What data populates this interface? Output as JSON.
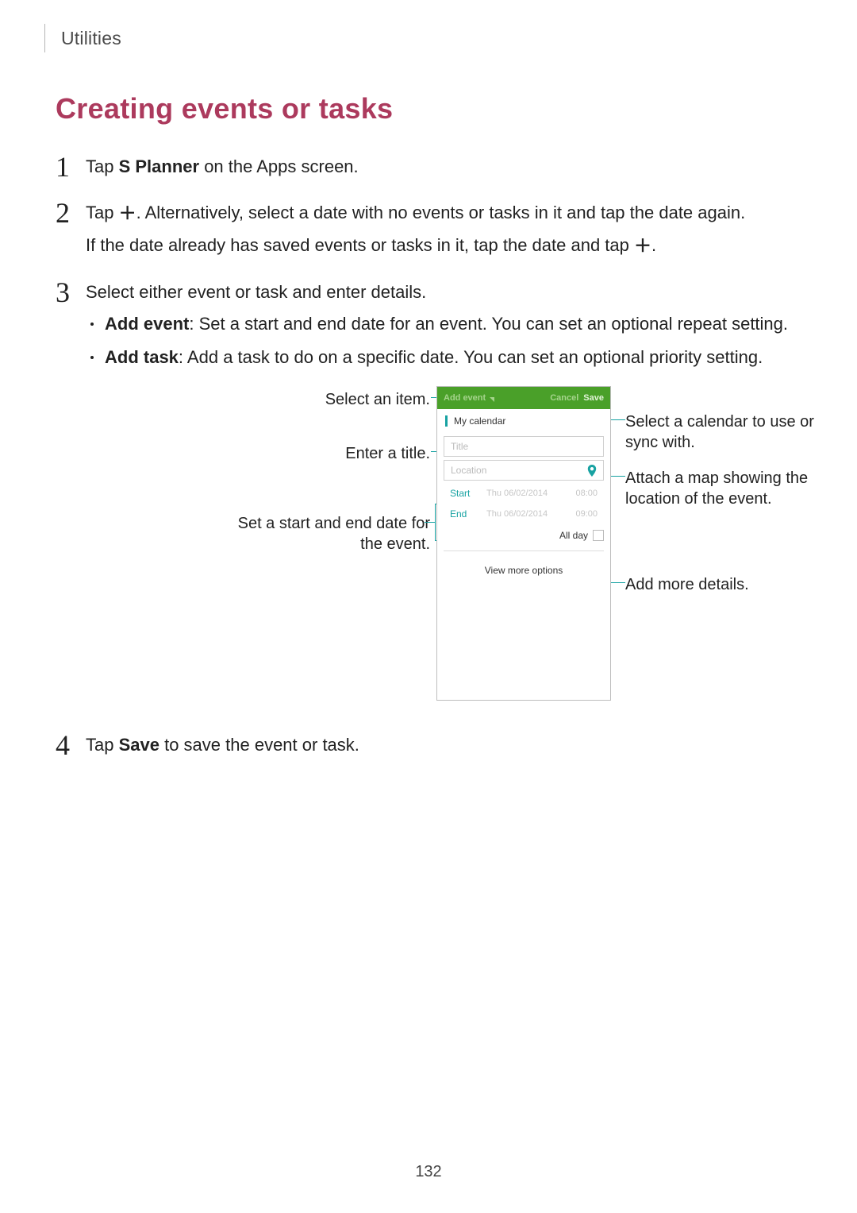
{
  "breadcrumb": "Utilities",
  "heading": "Creating events or tasks",
  "plus_glyph": "＋",
  "step1": {
    "pre": "Tap ",
    "bold": "S Planner",
    "post": " on the Apps screen."
  },
  "step2": {
    "line1_a": "Tap ",
    "line1_b": ". Alternatively, select a date with no events or tasks in it and tap the date again.",
    "line2_a": "If the date already has saved events or tasks in it, tap the date and tap ",
    "line2_b": "."
  },
  "step3": {
    "intro": "Select either event or task and enter details.",
    "bullet_event_bold": "Add event",
    "bullet_event_rest": ": Set a start and end date for an event. You can set an optional repeat setting.",
    "bullet_task_bold": "Add task",
    "bullet_task_rest": ": Add a task to do on a specific date. You can set an optional priority setting."
  },
  "step4": {
    "pre": "Tap ",
    "bold": "Save",
    "post": " to save the event or task."
  },
  "callouts": {
    "select_item": "Select an item.",
    "enter_title": "Enter a title.",
    "set_dates": "Set a start and end date for the event.",
    "select_calendar": "Select a calendar to use or sync with.",
    "attach_map": "Attach a map showing the location of the event.",
    "add_more": "Add more details."
  },
  "phone": {
    "header_label": "Add event",
    "header_cancel": "Cancel",
    "header_save": "Save",
    "calendar_name": "My calendar",
    "title_placeholder": "Title",
    "location_placeholder": "Location",
    "start_label": "Start",
    "start_date": "Thu 06/02/2014",
    "start_time": "08:00",
    "end_label": "End",
    "end_date": "Thu 06/02/2014",
    "end_time": "09:00",
    "all_day": "All day",
    "view_more": "View more options"
  },
  "page_number": "132"
}
